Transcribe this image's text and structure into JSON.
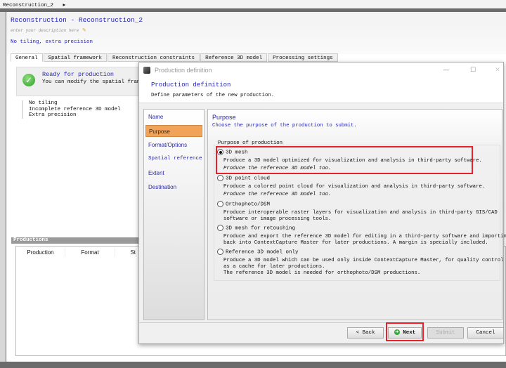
{
  "topbar": {
    "breadcrumb": "Reconstruction_2",
    "arrow": "▸"
  },
  "header": {
    "title": "Reconstruction - Reconstruction_2",
    "description_placeholder": "enter your description here",
    "summary": "No tiling, extra precision"
  },
  "tabs": [
    {
      "label": "General",
      "active": true
    },
    {
      "label": "Spatial framework"
    },
    {
      "label": "Reconstruction constraints"
    },
    {
      "label": "Reference 3D model"
    },
    {
      "label": "Processing settings"
    }
  ],
  "status": {
    "title": "Ready for production",
    "message": "You can modify the spatial framewor",
    "notes": [
      "No tiling",
      "Incomplete reference 3D model",
      "Extra precision"
    ]
  },
  "productions": {
    "title": "Productions",
    "columns": [
      "Production",
      "Format",
      "St"
    ]
  },
  "dialog": {
    "window_title": "Production definition",
    "title": "Production definition",
    "subtitle": "Define parameters of the new production.",
    "nav": [
      {
        "label": "Name"
      },
      {
        "label": "Purpose",
        "selected": true
      },
      {
        "label": "Format/Options"
      },
      {
        "label": "Spatial reference s"
      },
      {
        "label": "Extent"
      },
      {
        "label": "Destination"
      }
    ],
    "panel_title": "Purpose",
    "panel_subtitle": "Choose the purpose of the production to submit.",
    "group_label": "Purpose of production",
    "options": [
      {
        "label": "3D mesh",
        "selected": true,
        "desc": [
          "Produce a 3D model optimized for visualization and analysis in third-party software."
        ],
        "note": "Produce the reference 3D model too."
      },
      {
        "label": "3D point cloud",
        "desc": [
          "Produce a colored point cloud for visualization and analysis in third-party software."
        ],
        "note": "Produce the reference 3D model too."
      },
      {
        "label": "Orthophoto/DSM",
        "desc": [
          "Produce interoperable raster layers for visualization and analysis in third-party GIS/CAD",
          "software or image processing tools."
        ]
      },
      {
        "label": "3D mesh for retouching",
        "desc": [
          "Produce and export the reference 3D model for editing in a third-party software and importing",
          "back into ContextCapture Master for later productions. A margin is specially included."
        ]
      },
      {
        "label": "Reference 3D model only",
        "desc": [
          "Produce a 3D model which can be used only inside ContextCapture Master, for quality control and",
          "as a cache for later productions.",
          "The reference 3D model is needed for orthophoto/DSM productions."
        ]
      }
    ],
    "buttons": {
      "back": "< Back",
      "next": "Next",
      "submit": "Submit",
      "cancel": "Cancel"
    },
    "highlight_color": "#e8202a",
    "accent_color": "#f2a35a"
  }
}
